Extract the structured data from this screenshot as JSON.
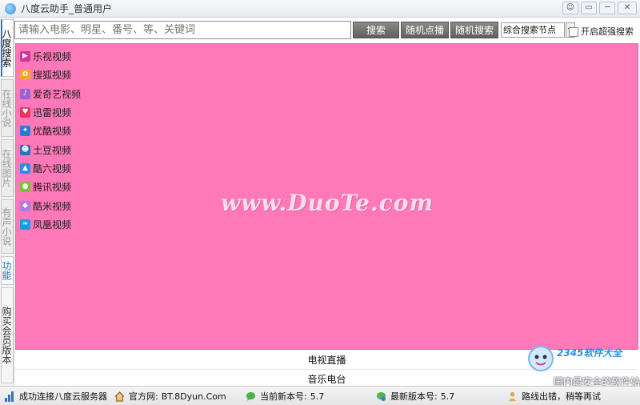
{
  "window": {
    "title": "八度云助手_普通用户",
    "controls": [
      "☺",
      "▭",
      "─",
      "✕"
    ]
  },
  "vtabs": [
    {
      "label": "八度搜索",
      "state": "active"
    },
    {
      "label": "在线小说",
      "state": "inactive"
    },
    {
      "label": "在线图片",
      "state": "inactive"
    },
    {
      "label": "有声小说",
      "state": "inactive"
    },
    {
      "label": "功能",
      "state": "func"
    },
    {
      "label": "购买会员版本",
      "state": "buy"
    }
  ],
  "search": {
    "placeholder": "请输入电影、明星、番号、等、关键词",
    "buttons": [
      "搜索",
      "随机点播",
      "随机搜索"
    ],
    "node_select": "综合搜索节点",
    "super_search_label": "开启超强搜索"
  },
  "sites": [
    {
      "label": "乐视视频",
      "icon": "letv-icon",
      "color": "#d2349a",
      "glyph": "▶"
    },
    {
      "label": "搜狐视频",
      "icon": "sohu-icon",
      "color": "#f3a81d",
      "glyph": "✿"
    },
    {
      "label": "爱奇艺视频",
      "icon": "iqiyi-icon",
      "color": "#9b60d6",
      "glyph": "♪"
    },
    {
      "label": "迅雷视频",
      "icon": "xunlei-icon",
      "color": "#e6335f",
      "glyph": "♥"
    },
    {
      "label": "优酷视频",
      "icon": "youku-icon",
      "color": "#2b7ad6",
      "glyph": "✦"
    },
    {
      "label": "土豆视频",
      "icon": "tudou-icon",
      "color": "#2c6fbd",
      "glyph": "☻"
    },
    {
      "label": "酷六视频",
      "icon": "ku6-icon",
      "color": "#2e8ae5",
      "glyph": "▲"
    },
    {
      "label": "腾讯视频",
      "icon": "tencent-icon",
      "color": "#7ac134",
      "glyph": "●"
    },
    {
      "label": "酷米视频",
      "icon": "kumi-icon",
      "color": "#b079e4",
      "glyph": "◆"
    },
    {
      "label": "凤凰视频",
      "icon": "ifeng-icon",
      "color": "#1d9be0",
      "glyph": "❧"
    }
  ],
  "watermark": "www.DuoTe.com",
  "lower_list": [
    "电视直播",
    "音乐电台"
  ],
  "status": {
    "connection": "成功连接八度云服务器",
    "website_label": "官方网:",
    "website": "BT.8Dyun.Com",
    "current_version_label": "当前新本号:",
    "current_version": "5.7",
    "latest_version_label": "最新版本号:",
    "latest_version": "5.7",
    "route_msg": "路线出错，稍等再试"
  },
  "branding": {
    "number_logo": "2345软件大全",
    "slogan": "国内最安全的软件站"
  },
  "colors": {
    "content_bg": "#ff79b9",
    "button_gray": "#6e6e6e",
    "accent_blue": "#2a79c9"
  }
}
